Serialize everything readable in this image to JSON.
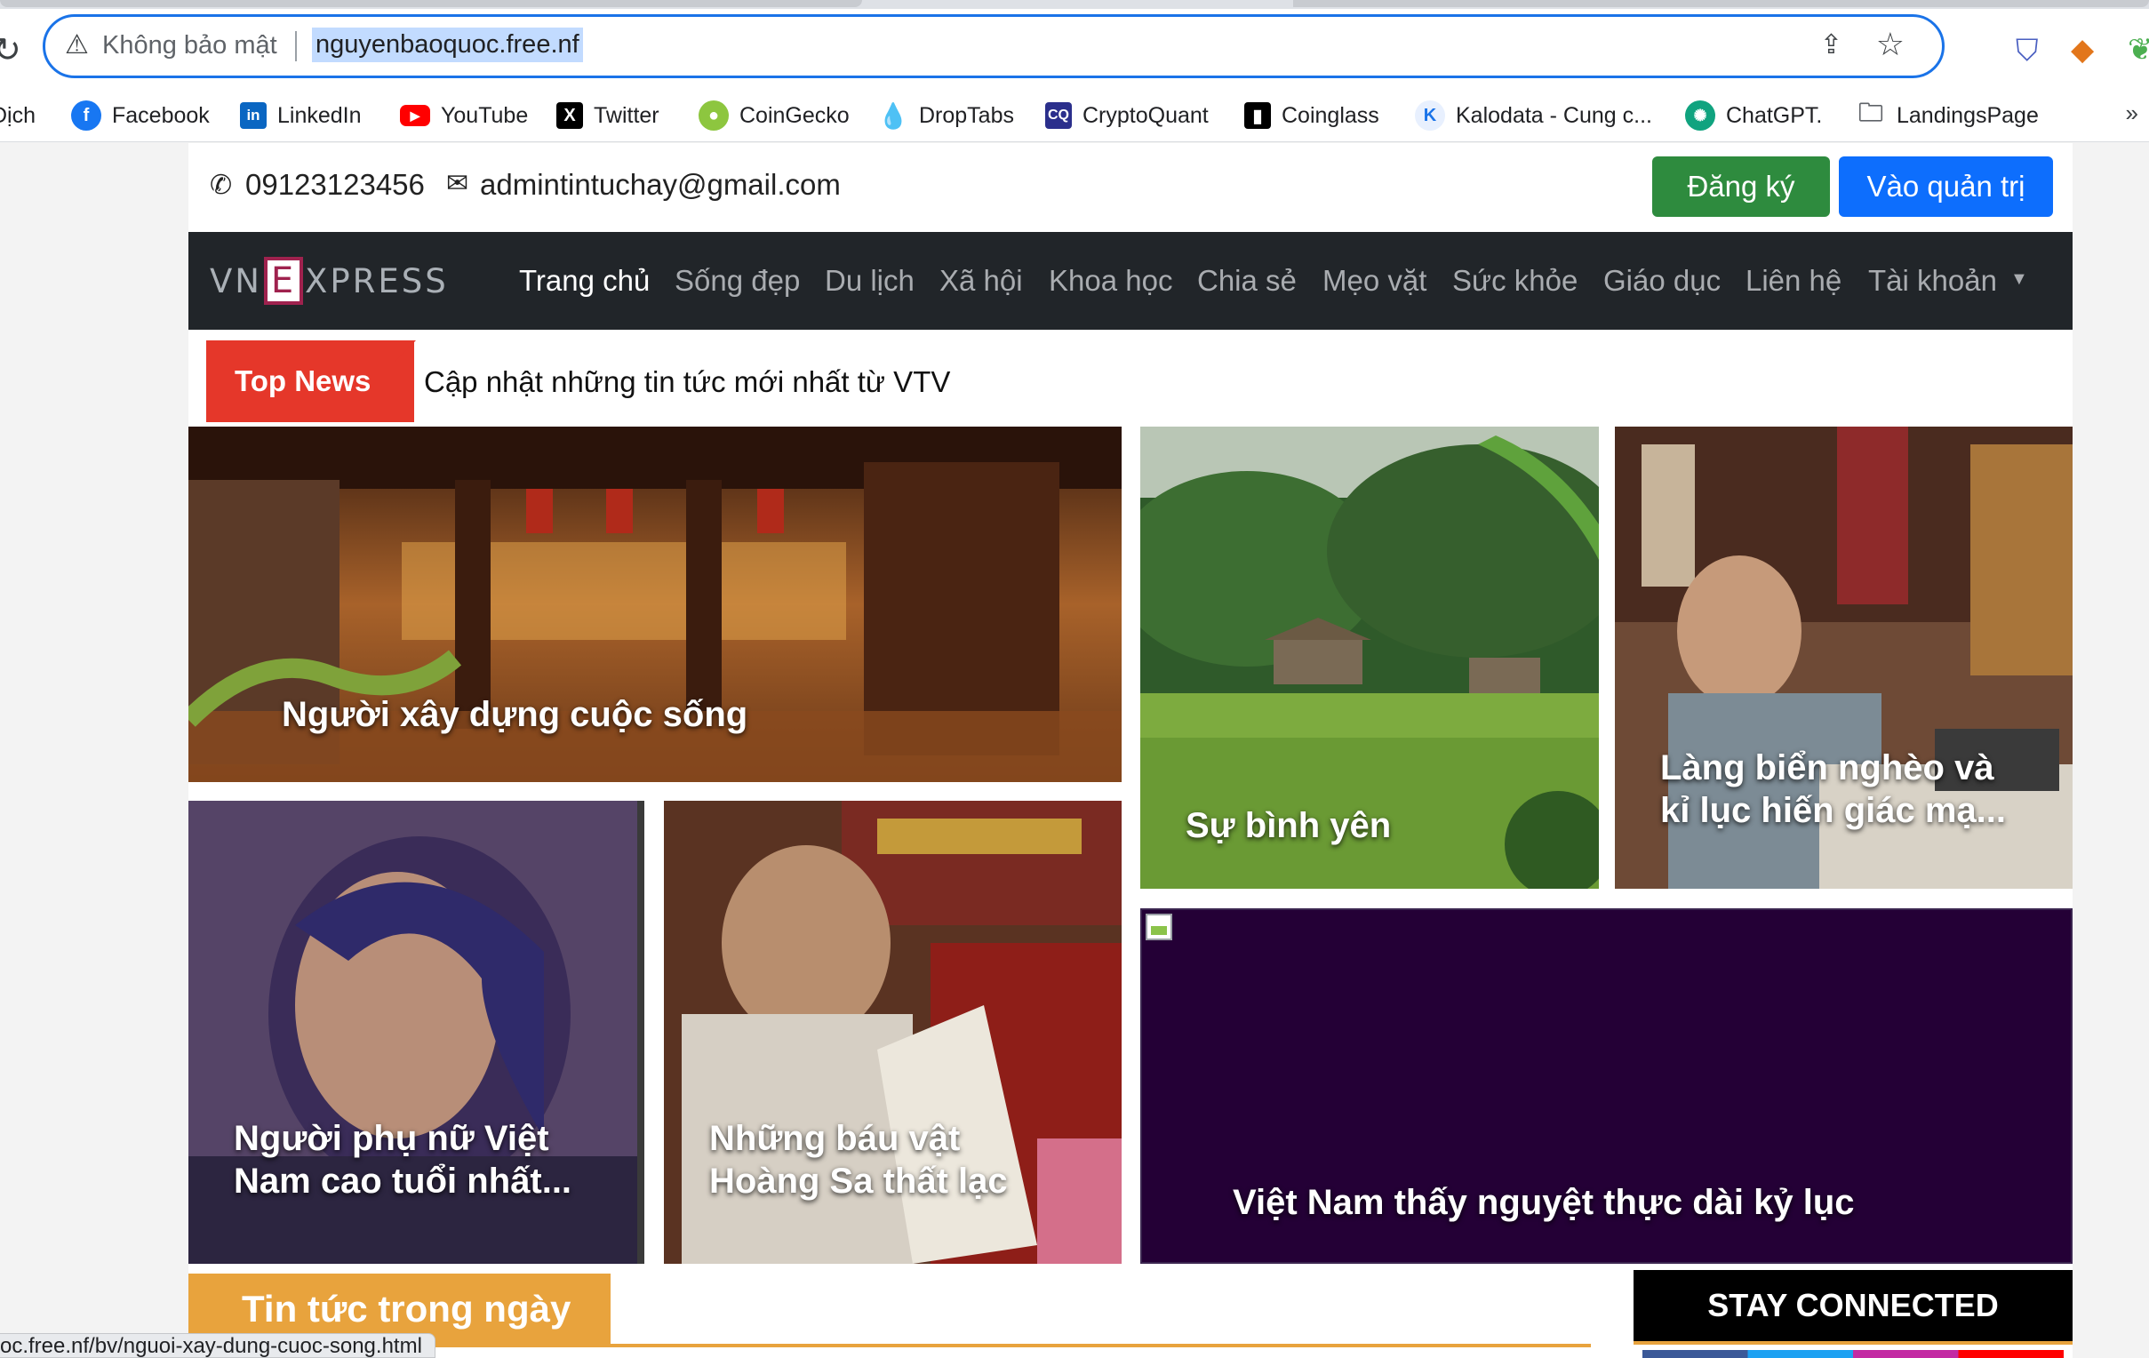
{
  "browser": {
    "insecure_label": "Không bảo mật",
    "url": "nguyenbaoquoc.free.nf",
    "status_url": "oc.free.nf/bv/nguoi-xay-dung-cuoc-song.html",
    "bookmarks": [
      {
        "label": "Dịch",
        "icon": "translate-icon"
      },
      {
        "label": "Facebook",
        "icon": "facebook-icon"
      },
      {
        "label": "LinkedIn",
        "icon": "linkedin-icon"
      },
      {
        "label": "YouTube",
        "icon": "youtube-icon"
      },
      {
        "label": "Twitter",
        "icon": "twitter-x-icon"
      },
      {
        "label": "CoinGecko",
        "icon": "coingecko-icon"
      },
      {
        "label": "DropTabs",
        "icon": "droptabs-icon"
      },
      {
        "label": "CryptoQuant",
        "icon": "cryptoquant-icon"
      },
      {
        "label": "Coinglass",
        "icon": "coinglass-icon"
      },
      {
        "label": "Kalodata - Cung c...",
        "icon": "kalodata-icon"
      },
      {
        "label": "ChatGPT.",
        "icon": "chatgpt-icon"
      },
      {
        "label": "LandingsPage",
        "icon": "folder-icon"
      }
    ],
    "more": "»"
  },
  "contact": {
    "phone": "09123123456",
    "email": "admintintuchay@gmail.com",
    "register_label": "Đăng ký",
    "admin_label": "Vào quản trị"
  },
  "nav": {
    "logo_left": "VN",
    "logo_mid": "E",
    "logo_right": "XPRESS",
    "items": [
      "Trang chủ",
      "Sống đẹp",
      "Du lịch",
      "Xã hội",
      "Khoa học",
      "Chia sẻ",
      "Mẹo vặt",
      "Sức khỏe",
      "Giáo dục",
      "Liên hệ",
      "Tài khoản"
    ]
  },
  "ticker": {
    "badge": "Top News",
    "text": "Cập nhật những tin tức mới nhất từ VTV"
  },
  "articles": [
    {
      "title": "Người xây dựng cuộc sống"
    },
    {
      "title": "Sự bình yên"
    },
    {
      "title_line1": "Làng biển nghèo và",
      "title_line2": "kỉ lục hiến giác mạ..."
    },
    {
      "title_line1": "Người phụ nữ Việt",
      "title_line2": "Nam cao tuổi nhất..."
    },
    {
      "title_line1": "Những báu vật",
      "title_line2": "Hoàng Sa thất lạc"
    },
    {
      "title": "Việt Nam thấy nguyệt thực dài kỷ lục"
    }
  ],
  "sections": {
    "today_news": "Tin tức trong ngày",
    "stay_connected": "STAY CONNECTED"
  },
  "colors": {
    "accent_red": "#e5372a",
    "register_green": "#2e8b3e",
    "admin_blue": "#0d6efd",
    "nav_dark": "#212529",
    "section_orange": "#e8a33d",
    "lunar_card": "#240036"
  }
}
